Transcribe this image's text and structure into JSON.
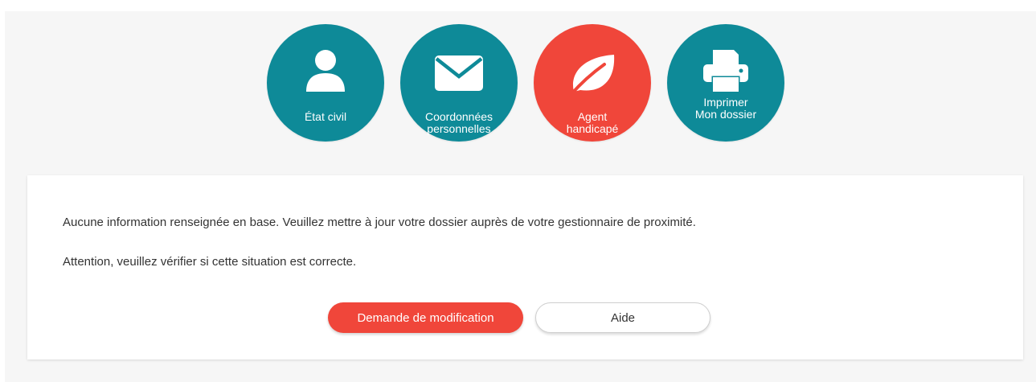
{
  "nav": {
    "items": [
      {
        "label": "État civil",
        "icon": "user-icon",
        "active": false
      },
      {
        "label": "Coordonnées\npersonnelles",
        "icon": "envelope-icon",
        "active": false
      },
      {
        "label": "Agent\nhandicapé",
        "icon": "leaf-icon",
        "active": true
      },
      {
        "label": "Imprimer\nMon dossier",
        "icon": "printer-icon",
        "active": false
      }
    ]
  },
  "content": {
    "message1": "Aucune information renseignée en base. Veuillez mettre à jour votre dossier auprès de votre gestionnaire de proximité.",
    "message2": "Attention, veuillez vérifier si cette situation est correcte."
  },
  "actions": {
    "request_label": "Demande de modification",
    "help_label": "Aide"
  },
  "colors": {
    "teal": "#0e8a98",
    "accent": "#f0463a"
  }
}
